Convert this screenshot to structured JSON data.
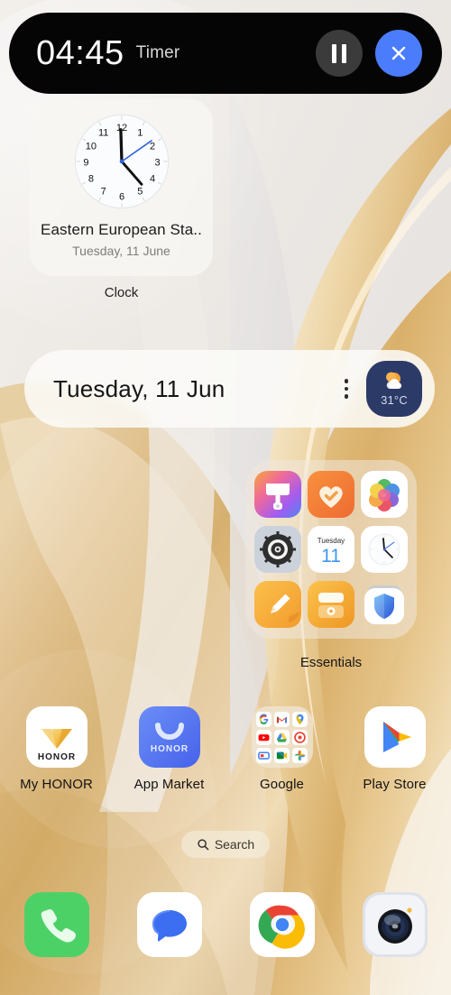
{
  "timer": {
    "time": "04:45",
    "label": "Timer",
    "pause_icon": "pause-icon",
    "close_icon": "close-icon"
  },
  "clock_widget": {
    "city": "Eastern European Sta..",
    "date": "Tuesday, 11 June",
    "widget_label": "Clock",
    "clock_icon": "analog-clock-icon",
    "hour_hand_deg": 2,
    "minute_hand_deg": 120,
    "second_hand_deg": 58
  },
  "date_widget": {
    "date": "Tuesday, 11 Jun",
    "menu_icon": "kebab-menu-icon",
    "weather_icon": "sun-behind-cloud-icon",
    "temperature": "31°C",
    "badge_color": "#2c3a68"
  },
  "essentials_folder": {
    "label": "Essentials",
    "apps": [
      {
        "name": "Themes",
        "icon": "paint-brush-icon"
      },
      {
        "name": "Health",
        "icon": "heart-check-icon"
      },
      {
        "name": "Gallery",
        "icon": "photo-petals-icon"
      },
      {
        "name": "Settings",
        "icon": "gear-icon"
      },
      {
        "name": "Calendar",
        "icon": "calendar-icon",
        "weekday": "Tuesday",
        "day": "11"
      },
      {
        "name": "Clock",
        "icon": "analog-clock-icon"
      },
      {
        "name": "Notes",
        "icon": "pencil-note-icon"
      },
      {
        "name": "Recorder",
        "icon": "recorder-icon"
      },
      {
        "name": "Security",
        "icon": "shield-icon"
      }
    ]
  },
  "app_row": [
    {
      "label": "My HONOR",
      "icon": "honor-diamond-icon",
      "brand_text": "HONOR"
    },
    {
      "label": "App Market",
      "icon": "honor-bag-icon",
      "brand_text": "HONOR"
    },
    {
      "label": "Google",
      "icon": "google-folder-icon"
    },
    {
      "label": "Play Store",
      "icon": "play-store-icon"
    }
  ],
  "google_folder_apps": [
    {
      "name": "Google",
      "icon": "google-g-icon"
    },
    {
      "name": "Gmail",
      "icon": "gmail-icon"
    },
    {
      "name": "Maps",
      "icon": "maps-pin-icon"
    },
    {
      "name": "YouTube",
      "icon": "youtube-icon"
    },
    {
      "name": "Drive",
      "icon": "drive-icon"
    },
    {
      "name": "Google One",
      "icon": "red-target-icon"
    },
    {
      "name": "Google TV",
      "icon": "google-tv-icon"
    },
    {
      "name": "Meet",
      "icon": "meet-camera-icon"
    },
    {
      "name": "Photos",
      "icon": "google-photos-icon"
    }
  ],
  "search": {
    "label": "Search",
    "icon": "search-icon"
  },
  "dock": [
    {
      "name": "Phone",
      "icon": "phone-icon",
      "color": "#4cd167"
    },
    {
      "name": "Messages",
      "icon": "message-bubble-icon",
      "color": "#3b6ef0"
    },
    {
      "name": "Chrome",
      "icon": "chrome-icon"
    },
    {
      "name": "Camera",
      "icon": "camera-icon"
    }
  ]
}
